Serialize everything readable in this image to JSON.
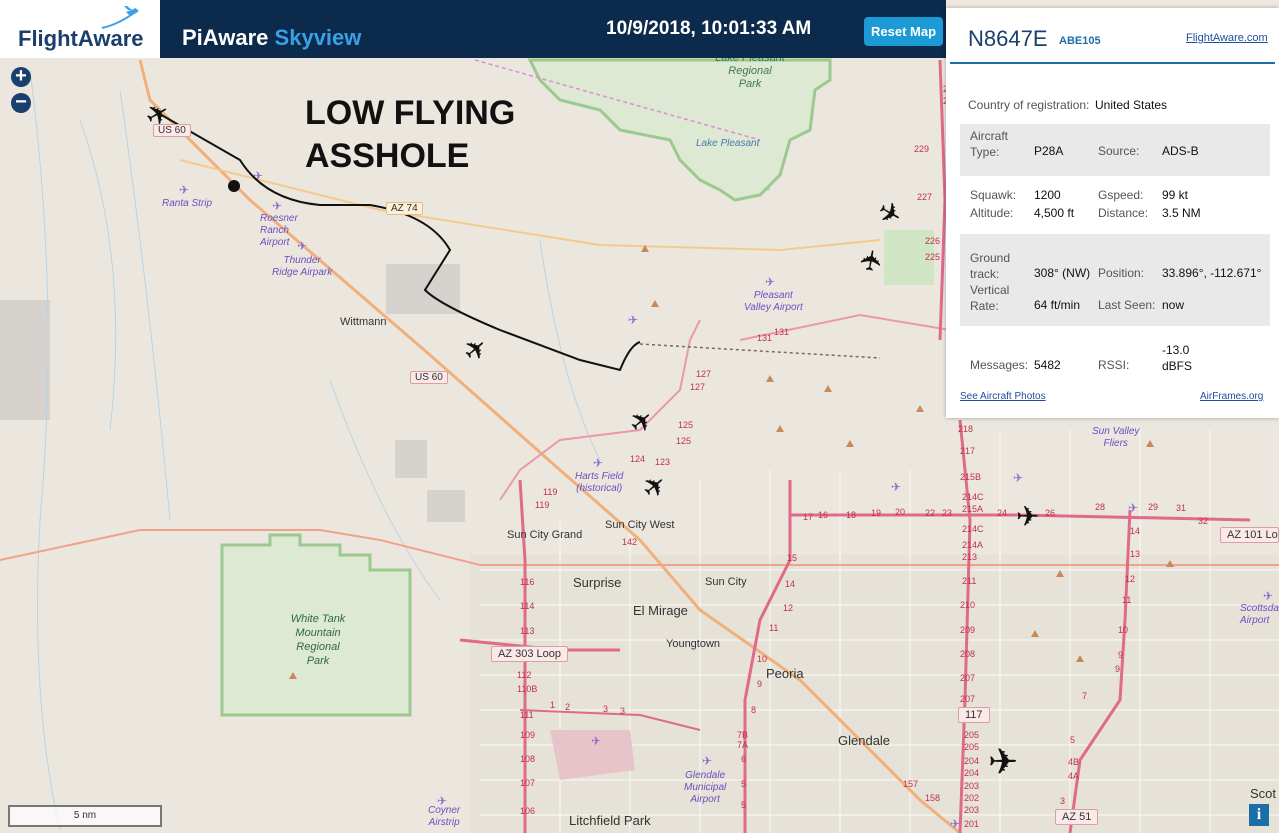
{
  "header": {
    "logo": "FlightAware",
    "title_main": "PiAware",
    "title_sub": "Skyview",
    "clock": "10/9/2018, 10:01:33 AM",
    "reset_label": "Reset Map"
  },
  "annotation": {
    "line1": "LOW FLYING",
    "line2": "ASSHOLE"
  },
  "map": {
    "zoom_in": "+",
    "zoom_out": "−",
    "scale": "5 nm",
    "info": "i",
    "places": [
      {
        "id": "place-lake-pleasant-park",
        "text": "Lake Pleasant\nRegional\nPark"
      },
      {
        "id": "place-lake-pleasant",
        "text": "Lake Pleasant"
      },
      {
        "id": "place-ranta",
        "text": "Ranta Strip"
      },
      {
        "id": "place-roesner",
        "text": "Roesner\nRanch\nAirport"
      },
      {
        "id": "place-thunder",
        "text": "Thunder\nRidge Airpark"
      },
      {
        "id": "place-wittmann",
        "text": "Wittmann"
      },
      {
        "id": "place-pleasant-valley",
        "text": "Pleasant\nValley Airport"
      },
      {
        "id": "place-harts",
        "text": "Harts Field\n(historical)"
      },
      {
        "id": "place-sun-city-west",
        "text": "Sun City West"
      },
      {
        "id": "place-sun-city-grand",
        "text": "Sun City Grand"
      },
      {
        "id": "place-surprise",
        "text": "Surprise"
      },
      {
        "id": "place-sun-city",
        "text": "Sun City"
      },
      {
        "id": "place-el-mirage",
        "text": "El Mirage"
      },
      {
        "id": "place-youngtown",
        "text": "Youngtown"
      },
      {
        "id": "place-peoria",
        "text": "Peoria"
      },
      {
        "id": "place-glendale",
        "text": "Glendale"
      },
      {
        "id": "place-white-tank",
        "text": "White Tank\nMountain\nRegional\nPark"
      },
      {
        "id": "place-glendale-airport",
        "text": "Glendale\nMunicipal\nAirport"
      },
      {
        "id": "place-coyner",
        "text": "Coyner\nAirstrip"
      },
      {
        "id": "place-litchfield",
        "text": "Litchfield Park"
      },
      {
        "id": "place-sun-valley",
        "text": "Sun Valley\nFliers"
      },
      {
        "id": "place-scottsdale",
        "text": "Scottsda\nAirport"
      },
      {
        "id": "place-scot",
        "text": "Scot"
      }
    ],
    "road_labels": [
      {
        "id": "road-us60-a",
        "text": "US 60"
      },
      {
        "id": "road-az74",
        "text": "AZ 74"
      },
      {
        "id": "road-us60-b",
        "text": "US 60"
      },
      {
        "id": "road-az303",
        "text": "AZ 303 Loop"
      },
      {
        "id": "road-az101",
        "text": "AZ 101 Loo"
      },
      {
        "id": "road-117",
        "text": "117"
      },
      {
        "id": "road-az51",
        "text": "AZ 51"
      }
    ]
  },
  "panel": {
    "registration": "N8647E",
    "callsign": "ABE105",
    "fa_link": "FlightAware.com",
    "country_label": "Country of registration:",
    "country_value": "United States",
    "aircraft_type_label": "Aircraft\nType:",
    "aircraft_type_value": "P28A",
    "source_label": "Source:",
    "source_value": "ADS-B",
    "squawk_label": "Squawk:",
    "squawk_value": "1200",
    "gspeed_label": "Gspeed:",
    "gspeed_value": "99 kt",
    "altitude_label": "Altitude:",
    "altitude_value": "4,500 ft",
    "distance_label": "Distance:",
    "distance_value": "3.5 NM",
    "track_label": "Ground\ntrack:",
    "track_value": "308° (NW)",
    "position_label": "Position:",
    "position_value": "33.896°, -112.671°",
    "vrate_label": "Vertical\nRate:",
    "vrate_value": "64 ft/min",
    "lastseen_label": "Last Seen:",
    "lastseen_value": "now",
    "messages_label": "Messages:",
    "messages_value": "5482",
    "rssi_label": "RSSI:",
    "rssi_value": "-13.0\ndBFS",
    "photos_link": "See Aircraft Photos",
    "airframes_link": "AirFrames.org"
  },
  "colors": {
    "header_bg": "#0b2a4c",
    "accent": "#1c9ad6",
    "park_border": "#9cc98f",
    "highway": "#e89aa8"
  }
}
